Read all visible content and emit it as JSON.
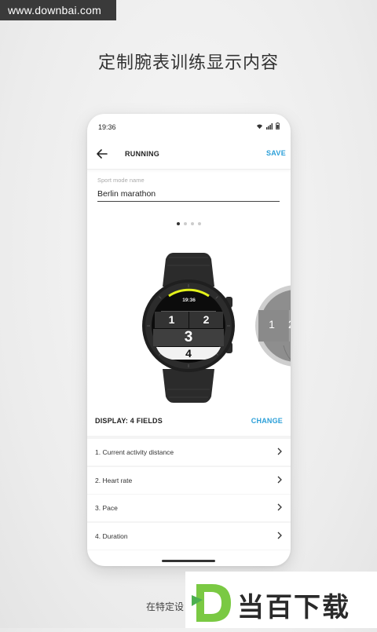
{
  "watermark": {
    "text": "www.downbai.com"
  },
  "headline": "定制腕表训练显示内容",
  "statusbar": {
    "time": "19:36"
  },
  "appbar": {
    "title": "RUNNING",
    "save_label": "SAVE"
  },
  "sport_mode": {
    "label": "Sport mode name",
    "value": "Berlin marathon"
  },
  "carousel": {
    "pages": 4,
    "active_index": 0
  },
  "watch": {
    "time": "19:36",
    "fields": [
      "1",
      "2",
      "3",
      "4"
    ],
    "accent_color": "#e4f21b",
    "next_preview_fields": [
      "1",
      "2"
    ]
  },
  "display": {
    "label": "DISPLAY: 4 FIELDS",
    "change_label": "CHANGE"
  },
  "fields_list": [
    {
      "label": "1. Current activity distance"
    },
    {
      "label": "2. Heart rate"
    },
    {
      "label": "3. Pace"
    },
    {
      "label": "4. Duration"
    }
  ],
  "bottom_caption": "在特定设",
  "logo": {
    "letter": "D",
    "text": "当百下载",
    "color": "#7ac943",
    "text_color": "#2a2a2a"
  },
  "colors": {
    "accent": "#2b9fd8"
  }
}
